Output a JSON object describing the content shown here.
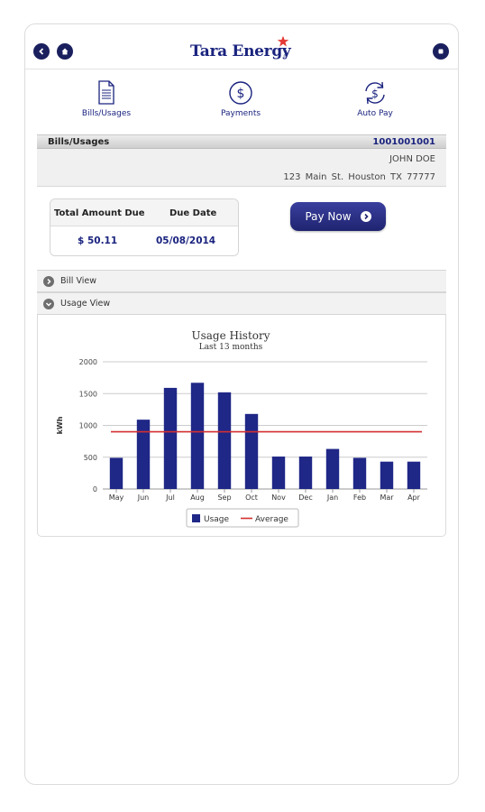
{
  "header": {
    "logo_text": "Tara Energy",
    "logo_tm": "®",
    "back_icon": "chevron-left-icon",
    "home_icon": "home-icon",
    "menu_icon": "menu-square-icon"
  },
  "nav": {
    "items": [
      {
        "label": "Bills/Usages",
        "icon": "document-icon"
      },
      {
        "label": "Payments",
        "icon": "dollar-circle-icon"
      },
      {
        "label": "Auto Pay",
        "icon": "autopay-refresh-icon"
      }
    ]
  },
  "section": {
    "title": "Bills/Usages",
    "account_number": "1001001001"
  },
  "customer": {
    "name": "JOHN DOE",
    "address": "123 Main St. Houston TX 77777"
  },
  "due": {
    "amount_label": "Total Amount Due",
    "date_label": "Due Date",
    "amount": "$ 50.11",
    "date": "05/08/2014"
  },
  "pay_button": {
    "label": "Pay Now"
  },
  "accordions": [
    {
      "label": "Bill View",
      "state": "collapsed"
    },
    {
      "label": "Usage View",
      "state": "expanded"
    }
  ],
  "colors": {
    "brand_navy": "#1a237e",
    "bar": "#1f2787",
    "average_line": "#d32f2f",
    "star": "#e53935"
  },
  "chart_data": {
    "type": "bar",
    "title": "Usage History",
    "subtitle": "Last 13 months",
    "ylabel": "kWh",
    "xlabel": "",
    "categories": [
      "May",
      "Jun",
      "Jul",
      "Aug",
      "Sep",
      "Oct",
      "Nov",
      "Dec",
      "Jan",
      "Feb",
      "Mar",
      "Apr"
    ],
    "series": [
      {
        "name": "Usage",
        "type": "bar",
        "values": [
          490,
          1090,
          1590,
          1670,
          1520,
          1180,
          510,
          510,
          630,
          490,
          430,
          430
        ]
      },
      {
        "name": "Average",
        "type": "line",
        "values": [
          900,
          900,
          900,
          900,
          900,
          900,
          900,
          900,
          900,
          900,
          900,
          900
        ]
      }
    ],
    "ylim": [
      0,
      2000
    ],
    "yticks": [
      0,
      500,
      1000,
      1500,
      2000
    ],
    "grid": true,
    "legend": "bottom-center"
  }
}
